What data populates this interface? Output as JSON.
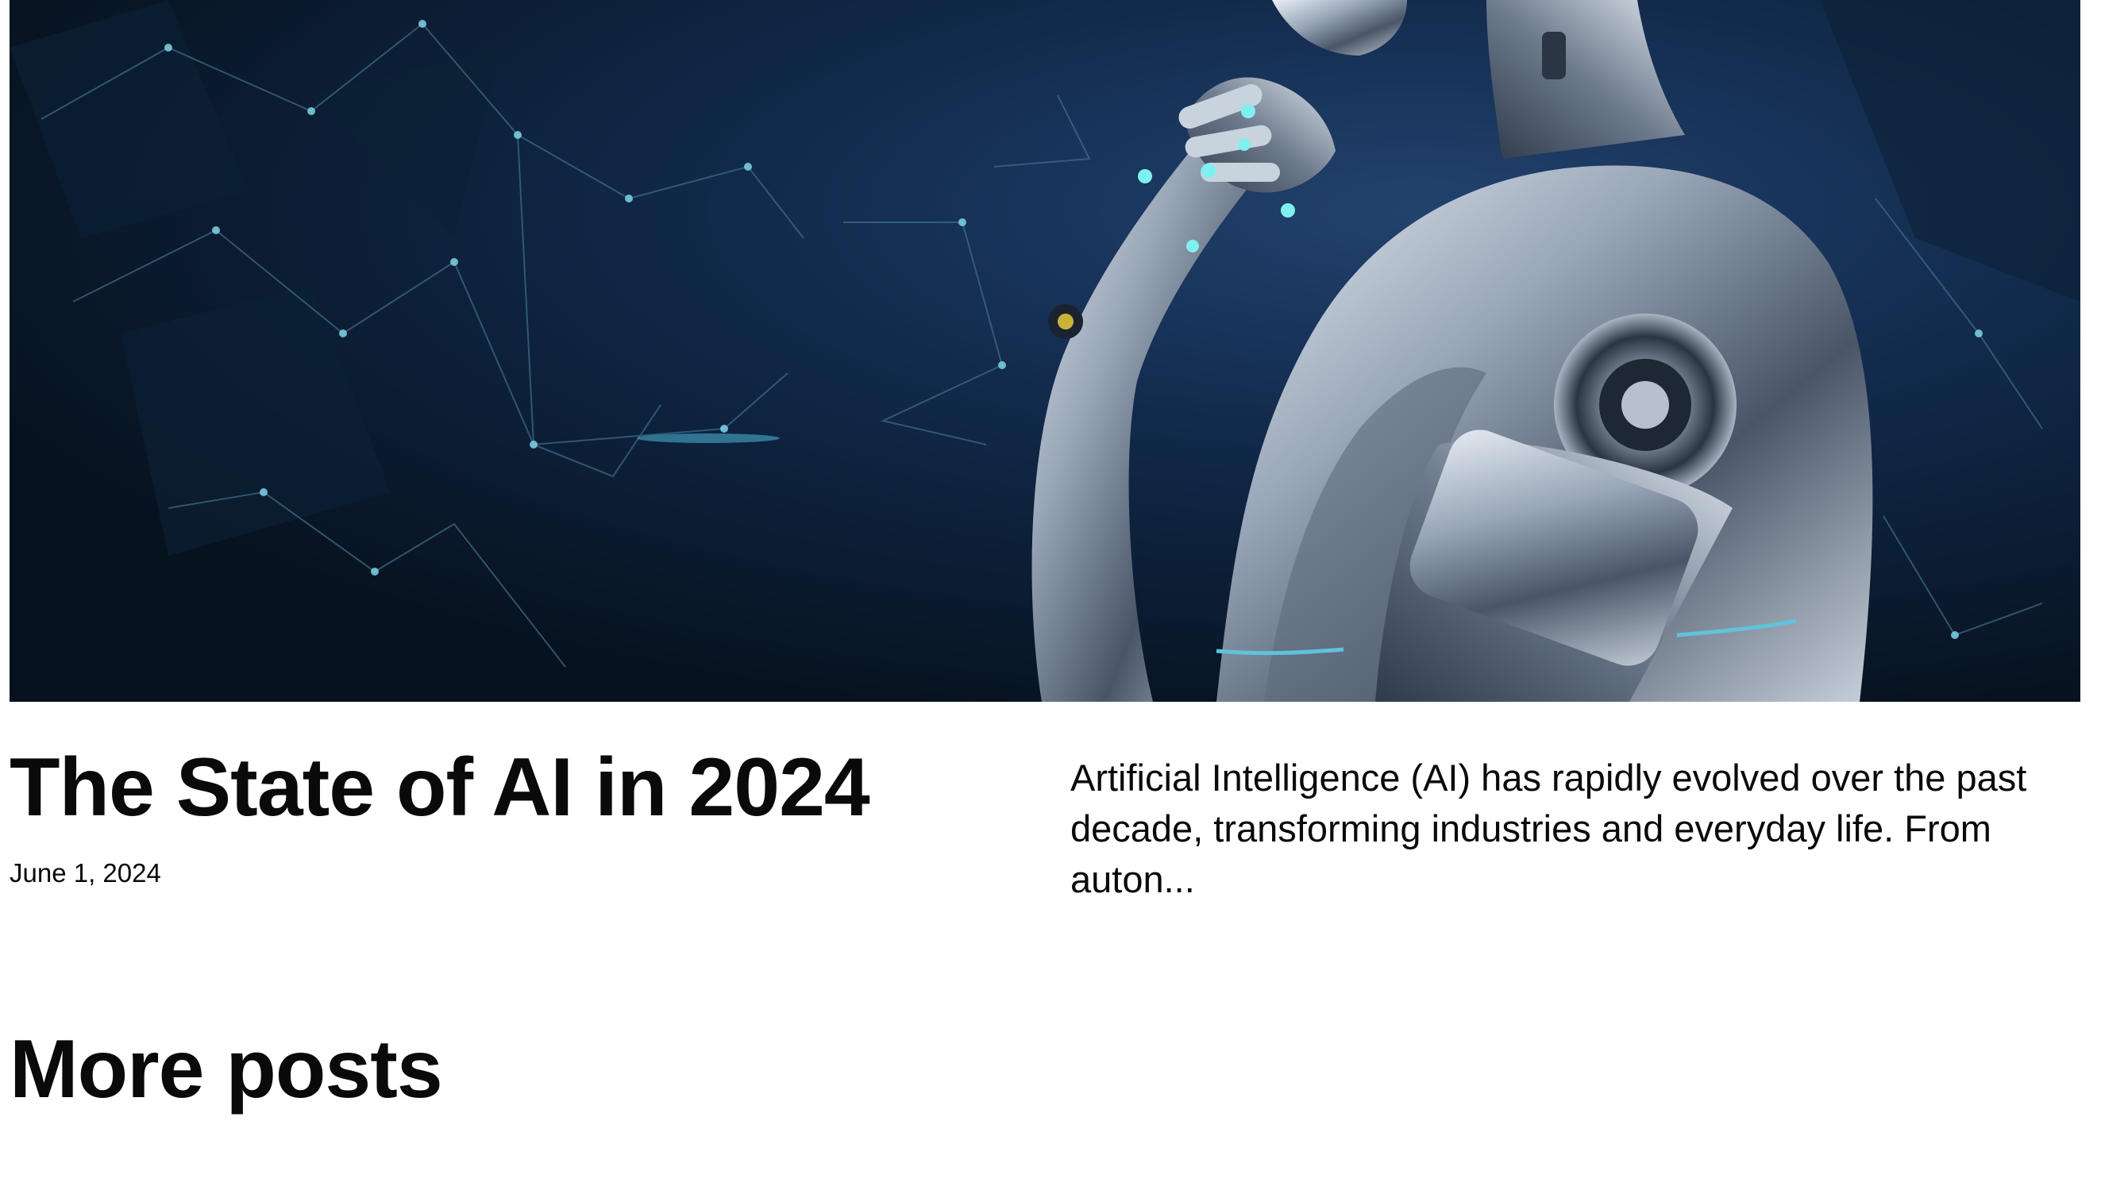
{
  "hero": {
    "image_alt": "Silver humanoid robot in a thinking pose against a dark blue network background"
  },
  "post": {
    "title": "The State of AI in 2024",
    "date": "June 1, 2024",
    "excerpt": "Artificial Intelligence (AI) has rapidly evolved over the past decade, transforming industries and everyday life. From auton..."
  },
  "more_posts": {
    "heading": "More posts"
  },
  "colors": {
    "background": "#ffffff",
    "text": "#0a0a0a",
    "hero_dark": "#081426",
    "hero_mid": "#1d3a63"
  }
}
